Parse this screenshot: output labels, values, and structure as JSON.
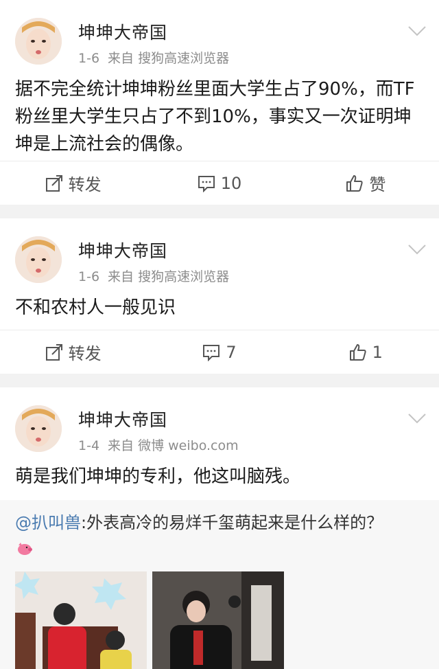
{
  "posts": [
    {
      "username": "坤坤大帝国",
      "date": "1-6",
      "source": "来自 搜狗高速浏览器",
      "lines": [
        "据不完全统计坤坤粉丝里面大学生占了90%，而TF",
        "粉丝里大学生只占了不到10%，事实又一次证明坤",
        "坤是上流社会的偶像。"
      ],
      "repost_label": "转发",
      "comment_count": "10",
      "like_label": "赞"
    },
    {
      "username": "坤坤大帝国",
      "date": "1-6",
      "source": "来自 搜狗高速浏览器",
      "lines": [
        "不和农村人一般见识"
      ],
      "repost_label": "转发",
      "comment_count": "7",
      "like_label": "1"
    },
    {
      "username": "坤坤大帝国",
      "date": "1-4",
      "source": "来自 微博 weibo.com",
      "lines": [
        "萌是我们坤坤的专利，他这叫脑残。"
      ],
      "quote": {
        "mention": "@扒叫兽",
        "text": ":外表高冷的易烊千玺萌起来是什么样的？"
      }
    }
  ],
  "icons": {
    "repost": "repost-icon",
    "comment": "comment-icon",
    "like": "thumb-up-icon",
    "menu": "chevron-down-icon"
  },
  "colors": {
    "mention": "#4a7bb0",
    "meta": "#8c8c8c",
    "separator": "#f2f2f2"
  }
}
